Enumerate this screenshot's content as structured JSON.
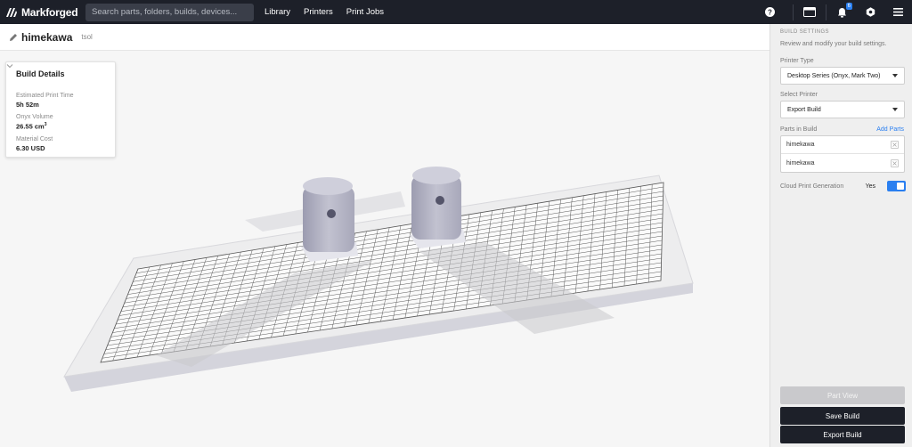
{
  "topbar": {
    "brand": "Markforged",
    "search_placeholder": "Search parts, folders, builds, devices...",
    "nav": [
      "Library",
      "Printers",
      "Print Jobs"
    ],
    "notification_count": "6",
    "icons": [
      "help-icon",
      "screen-icon",
      "bell-icon",
      "settings-icon",
      "menu-icon"
    ]
  },
  "build": {
    "title": "himekawa",
    "owner": "tsol"
  },
  "details": {
    "title": "Build Details",
    "time_label": "Estimated Print Time",
    "time_value": "5h 52m",
    "volume_label": "Onyx Volume",
    "volume_value": "26.55 cm",
    "volume_unit_exp": "3",
    "cost_label": "Material Cost",
    "cost_value": "6.30 USD"
  },
  "panel": {
    "heading": "BUILD SETTINGS",
    "subheading": "Review and modify your build settings.",
    "printer_type_label": "Printer Type",
    "printer_type_value": "Desktop Series (Onyx, Mark Two)",
    "select_printer_label": "Select Printer",
    "select_printer_value": "Export Build",
    "parts_label": "Parts in Build",
    "add_parts": "Add Parts",
    "parts": [
      "himekawa",
      "himekawa"
    ],
    "cloud_label": "Cloud Print Generation",
    "cloud_value": "Yes",
    "cloud_enabled": true,
    "btn_part_view": "Part View",
    "btn_save": "Save Build",
    "btn_export": "Export Build"
  },
  "colors": {
    "nav_bg": "#1d2029",
    "accent": "#2a7ff0",
    "panel_bg": "#efefef",
    "part_color": "#b3b3c3"
  }
}
